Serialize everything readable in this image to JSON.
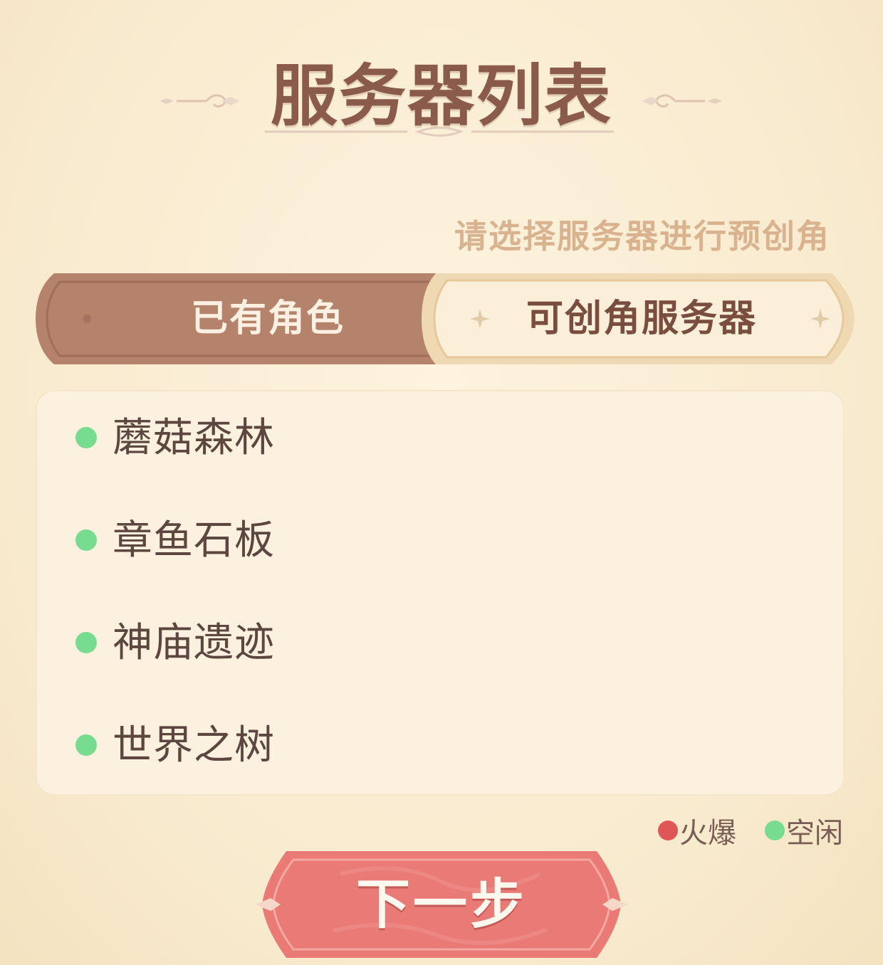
{
  "page": {
    "title": "服务器列表",
    "subtitle": "请选择服务器进行预创角"
  },
  "tabs": {
    "owned_label": "已有角色",
    "create_label": "可创角服务器",
    "active": "create"
  },
  "servers": [
    {
      "name": "蘑菇森林",
      "status": "空闲"
    },
    {
      "name": "章鱼石板",
      "status": "空闲"
    },
    {
      "name": "神庙遗迹",
      "status": "空闲"
    },
    {
      "name": "世界之树",
      "status": "空闲"
    }
  ],
  "legend": {
    "hot_label": "火爆",
    "idle_label": "空闲"
  },
  "actions": {
    "next_label": "下一步"
  },
  "colors": {
    "title": "#8a5a4a",
    "subtitle": "#d9b38f",
    "tab_inactive": "#b5826b",
    "tab_active": "#fbebd1",
    "status_hot": "#e05555",
    "status_idle": "#77db90",
    "button": "#e97a76"
  }
}
